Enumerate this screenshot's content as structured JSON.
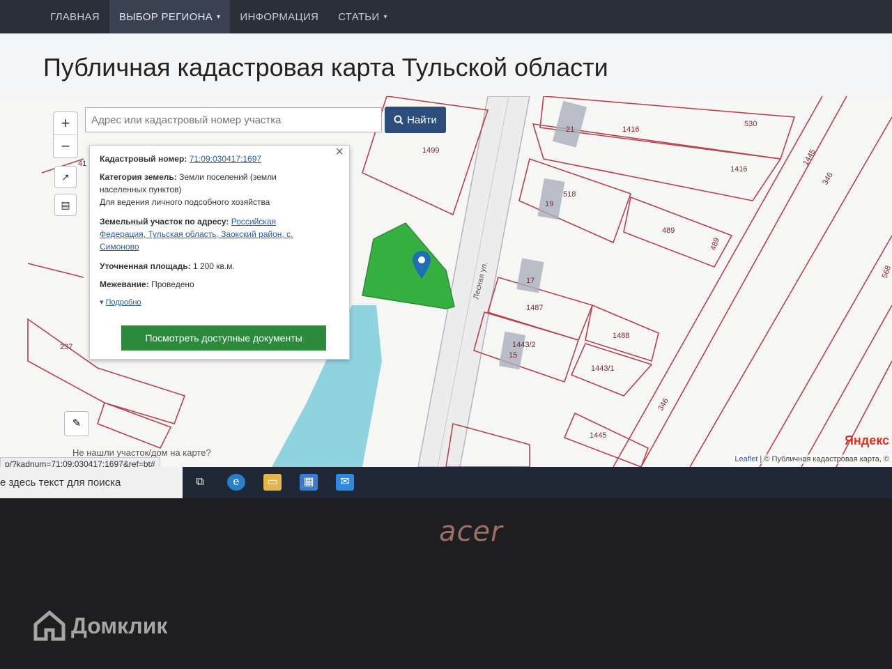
{
  "nav": {
    "items": [
      "ГЛАВНАЯ",
      "ВЫБОР РЕГИОНА",
      "ИНФОРМАЦИЯ",
      "СТАТЬИ"
    ]
  },
  "page": {
    "title": "Публичная кадастровая карта Тульской области"
  },
  "search": {
    "placeholder": "Адрес или кадастровый номер участка",
    "button_label": "Найти"
  },
  "map": {
    "parcel_labels": [
      "1499",
      "21",
      "1416",
      "530",
      "1416",
      "518",
      "19",
      "489",
      "489",
      "17",
      "1487",
      "1488",
      "1443/2",
      "15",
      "1443/1",
      "1445",
      "346",
      "346",
      "1445",
      "237",
      "41",
      "568"
    ],
    "street_label": "Лесная ул."
  },
  "popup": {
    "cadastral_number_label": "Кадастровый номер:",
    "cadastral_number": "71:09:030417:1697",
    "category_label": "Категория земель:",
    "category_value_1": "Земли поселений (земли",
    "category_value_2": "населенных пунктов)",
    "purpose": "Для ведения личного подсобного хозяйства",
    "address_label": "Земельный участок по адресу:",
    "address_value_1": "Российская",
    "address_value_2": "Федерация, Тульская область, Заокский район, с.",
    "address_value_3": "Симоново",
    "area_label": "Уточненная площадь:",
    "area_value": "1 200 кв.м.",
    "survey_label": "Межевание:",
    "survey_value": "Проведено",
    "details_link": "Подробно",
    "docs_button": "Посмотреть доступные документы"
  },
  "map_controls": {
    "zoom_in": "+",
    "zoom_out": "−",
    "hint_link": "Не нашли участок/дом на карте?"
  },
  "status_url": "p/?kadnum=71:09:030417:1697&ref=bt#",
  "attribution": {
    "leaflet": "Leaflet",
    "source": "© Публичная кадастровая карта, ©"
  },
  "yandex": "Яндекс",
  "taskbar": {
    "search_text": "е здесь текст для поиска"
  },
  "laptop": {
    "brand": "acer"
  },
  "watermark": {
    "text": "Домклик"
  }
}
